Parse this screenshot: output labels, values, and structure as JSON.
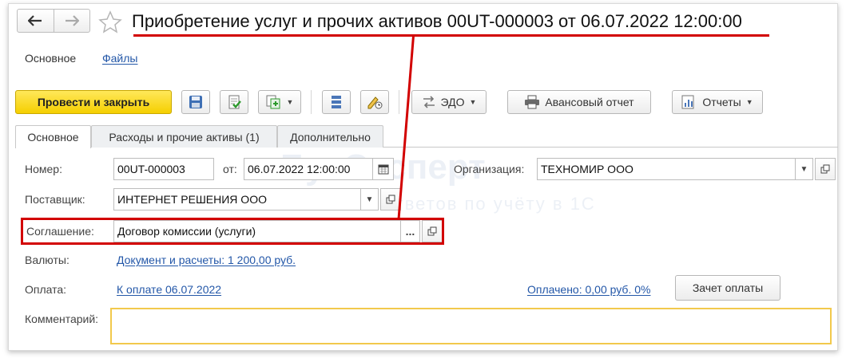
{
  "header": {
    "title": "Приобретение услуг и прочих активов 00UT-000003 от 06.07.2022 12:00:00"
  },
  "sections": {
    "main": "Основное",
    "files": "Файлы"
  },
  "toolbar": {
    "post_and_close": "Провести и закрыть",
    "edo": "ЭДО",
    "advance_report": "Авансовый отчет",
    "reports": "Отчеты"
  },
  "tabs": [
    {
      "label": "Основное",
      "active": true
    },
    {
      "label": "Расходы и прочие активы (1)",
      "active": false
    },
    {
      "label": "Дополнительно",
      "active": false
    }
  ],
  "form": {
    "number_label": "Номер:",
    "number_value": "00UT-000003",
    "date_label": "от:",
    "date_value": "06.07.2022 12:00:00",
    "organization_label": "Организация:",
    "organization_value": "ТЕХНОМИР ООО",
    "supplier_label": "Поставщик:",
    "supplier_value": "ИНТЕРНЕТ РЕШЕНИЯ ООО",
    "agreement_label": "Соглашение:",
    "agreement_value": "Договор комиссии (услуги)",
    "currency_label": "Валюты:",
    "currency_link": "Документ и расчеты: 1 200,00 руб.",
    "payment_label": "Оплата:",
    "payment_link": "К оплате 06.07.2022",
    "paid_link": "Оплачено: 0,00 руб. 0%",
    "offset_button": "Зачет оплаты",
    "comment_label": "Комментарий:",
    "comment_value": ""
  },
  "watermark": {
    "brand": "БухЭксперт",
    "tagline": "База ответов по учёту в 1С"
  },
  "colors": {
    "accent_red": "#d20000",
    "primary_button": "#f5cf00",
    "link": "#2357a8",
    "comment_border": "#f2c94c"
  }
}
